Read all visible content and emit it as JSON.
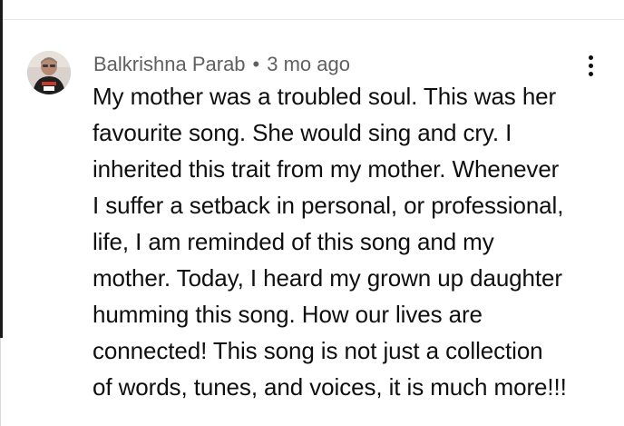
{
  "comment": {
    "author": "Balkrishna Parab",
    "separator": "•",
    "timestamp": "3 mo ago",
    "menu_icon": "more-vertical-icon",
    "text_lines": [
      "My mother was a troubled soul. This was her",
      "favourite song. She would sing and cry. I",
      "inherited this trait from my mother. Whenever",
      "I suffer a setback in personal, or professional,",
      "life, I am reminded of this song and my",
      "mother. Today, I heard my grown up daughter",
      "humming this song. How our lives are",
      "connected! This song is not just a collection",
      "of words, tunes, and voices, it is much more!!!"
    ]
  },
  "colors": {
    "meta_text": "#606060",
    "body_text": "#0f0f0f",
    "background": "#ffffff"
  }
}
